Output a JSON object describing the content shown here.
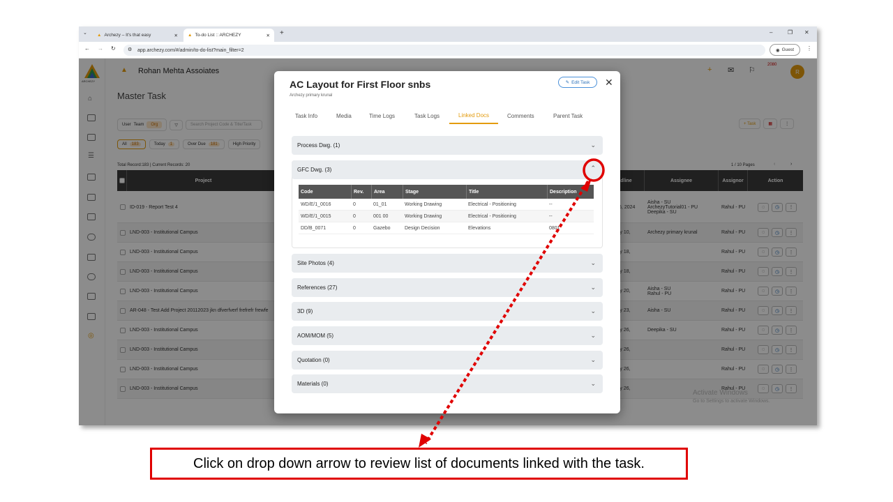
{
  "browser": {
    "tabs": [
      {
        "title": "Archezy – It's that easy"
      },
      {
        "title": "To-do List :: ARCHEZY"
      }
    ],
    "url": "app.archezy.com/#/admin/to-do-list?main_filter=2",
    "profile": "Guest"
  },
  "app": {
    "company": "Rohan Mehta Assoiates",
    "page_title": "Master Task",
    "logo_text": "ARCHEZY",
    "user_initial": "R",
    "notif_count": "2080",
    "toggle": [
      "User",
      "Team",
      "Org"
    ],
    "search_placeholder": "Search Project Code & Title/Task",
    "add_task": "+ Task",
    "filters": [
      {
        "label": "All",
        "count": "183"
      },
      {
        "label": "Today",
        "count": "1"
      },
      {
        "label": "Over Due",
        "count": "181"
      },
      {
        "label": "High Priority",
        "count": ""
      }
    ],
    "records": "Total Record:183 | Current Records: 20",
    "pages": "1 / 10 Pages",
    "columns": [
      "Project",
      "adline",
      "Assignee",
      "Assignor",
      "Action"
    ],
    "rows": [
      {
        "project": "ID-019 - Report Test 4",
        "deadline": "y 6, 2024",
        "assignee": [
          "Aisha - SU",
          "ArchezyTutorial01 - PU",
          "Deepika - SU"
        ],
        "assignor": "Rahul - PU"
      },
      {
        "project": "LND-003 - Institutional Campus",
        "deadline": "y 10,",
        "assignee": [
          "Archezy primary krunal"
        ],
        "assignor": "Rahul - PU"
      },
      {
        "project": "LND-003 - Institutional Campus",
        "deadline": "y 18,",
        "assignee": [],
        "assignor": "Rahul - PU"
      },
      {
        "project": "LND-003 - Institutional Campus",
        "deadline": "y 18,",
        "assignee": [],
        "assignor": "Rahul - PU"
      },
      {
        "project": "LND-003 - Institutional Campus",
        "deadline": "y 20,",
        "assignee": [
          "Aisha - SU",
          "Rahul - PU"
        ],
        "assignor": "Rahul - PU"
      },
      {
        "project": "AR-048 - Test Add Project 20112023 jkn dfverfverf frefrefr frewfe",
        "deadline": "y 23,",
        "assignee": [
          "Aisha - SU"
        ],
        "assignor": "Rahul - PU"
      },
      {
        "project": "LND-003 - Institutional Campus",
        "deadline": "y 26,",
        "assignee": [
          "Deepika - SU"
        ],
        "assignor": "Rahul - PU"
      },
      {
        "project": "LND-003 - Institutional Campus",
        "deadline": "y 26,",
        "assignee": [],
        "assignor": "Rahul - PU"
      },
      {
        "project": "LND-003 - Institutional Campus",
        "deadline": "y 26,",
        "assignee": [],
        "assignor": "Rahul - PU"
      },
      {
        "project": "LND-003 - Institutional Campus",
        "deadline": "y 26,",
        "assignee": [],
        "assignor": "Rahul - PU"
      }
    ],
    "watermark": [
      "Activate Windows",
      "Go to Settings to activate Windows."
    ]
  },
  "modal": {
    "title": "AC Layout for First Floor snbs",
    "subtitle": "Archezy primary krunal",
    "edit_label": "Edit Task",
    "tabs": [
      "Task Info",
      "Media",
      "Time Logs",
      "Task Logs",
      "Linked Docs",
      "Comments",
      "Parent Task"
    ],
    "active_tab": "Linked Docs",
    "sections": [
      "Process Dwg. (1)",
      "GFC Dwg. (3)",
      "Site Photos (4)",
      "References (27)",
      "3D (9)",
      "AOM/MOM (5)",
      "Quotation (0)",
      "Materials (0)"
    ],
    "doc_columns": [
      "Code",
      "Rev.",
      "Area",
      "Stage",
      "Title",
      "Description"
    ],
    "docs": [
      [
        "WD/E/1_0016",
        "0",
        "01_01",
        "Working Drawing",
        "Electrical - Positioning",
        "--"
      ],
      [
        "WD/E/1_0015",
        "0",
        "001 00",
        "Working Drawing",
        "Electrical - Positioning",
        "--"
      ],
      [
        "DD/B_0071",
        "0",
        "Gazebo",
        "Design Decision",
        "Elevations",
        "0801"
      ]
    ]
  },
  "callout": "Click on drop down arrow to review list of documents linked with the task.",
  "colors": {
    "accent": "#e39b0e",
    "highlight": "#e00000",
    "header": "#3b3b3b"
  }
}
